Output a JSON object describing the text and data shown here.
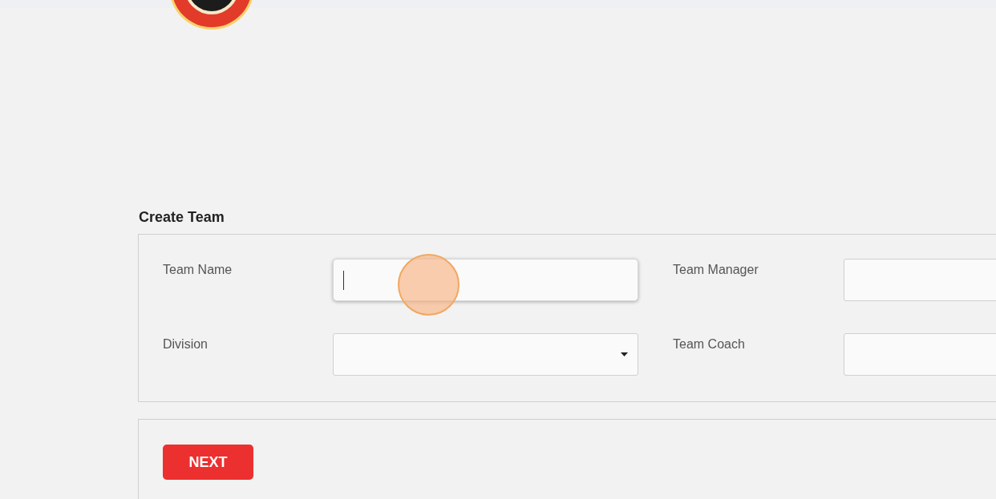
{
  "section_title": "Create Team",
  "fields": [
    {
      "label": "Team Name",
      "kind": "text",
      "focused": true
    },
    {
      "label": "Team Manager",
      "kind": "text",
      "focused": false
    },
    {
      "label": "Division",
      "kind": "select",
      "focused": false
    },
    {
      "label": "Team Coach",
      "kind": "text",
      "focused": false
    }
  ],
  "click_indicator": {
    "shown": true
  },
  "buttons": [
    {
      "label": "NEXT"
    }
  ]
}
